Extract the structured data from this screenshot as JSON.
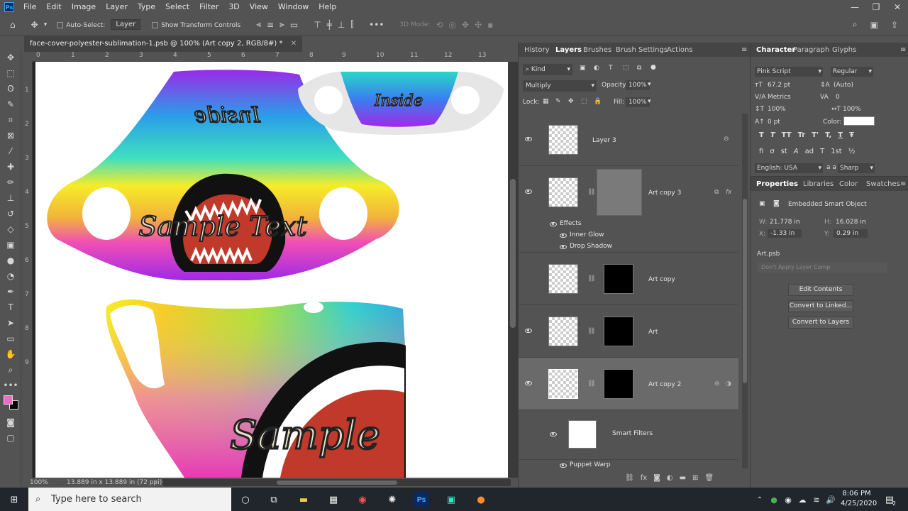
{
  "menubar": {
    "logo": "Ps",
    "items": [
      "File",
      "Edit",
      "Image",
      "Layer",
      "Type",
      "Select",
      "Filter",
      "3D",
      "View",
      "Window",
      "Help"
    ]
  },
  "options": {
    "auto_select": "Auto-Select:",
    "auto_select_value": "Layer",
    "transform_controls": "Show Transform Controls",
    "mode_3d": "3D Mode:"
  },
  "document": {
    "tab_title": "face-cover-polyester-sublimation-1.psb @ 100% (Art copy 2, RGB/8#) *",
    "zoom": "100%",
    "doc_size": "13.889 in x 13.889 in (72 ppi)",
    "ruler_h": [
      "0",
      "1",
      "2",
      "3",
      "4",
      "5",
      "6",
      "7",
      "8",
      "9",
      "10",
      "11",
      "12",
      "13"
    ],
    "ruler_v": [
      "1",
      "2",
      "3",
      "4",
      "5",
      "6",
      "7",
      "8",
      "9"
    ],
    "mask_top_text": "Inside",
    "mask_main_text": "Sample Text",
    "mask_flip_text": "Inside",
    "mask_3d_text": "Sample"
  },
  "layers_panel": {
    "tabs": [
      "History",
      "Layers",
      "Brushes",
      "Brush Settings",
      "Actions"
    ],
    "active_tab": "Layers",
    "filter_kind": "Kind",
    "blend_mode": "Multiply",
    "opacity_label": "Opacity:",
    "opacity": "100%",
    "lock_label": "Lock:",
    "fill_label": "Fill:",
    "fill": "100%",
    "layers": [
      {
        "name": "Layer 3"
      },
      {
        "name": "Art copy 3"
      },
      {
        "name": "Art copy"
      },
      {
        "name": "Art"
      },
      {
        "name": "Art copy 2"
      }
    ],
    "effects_label": "Effects",
    "effects": [
      "Inner Glow",
      "Drop Shadow"
    ],
    "smart_filters": "Smart Filters",
    "puppet_warp": "Puppet Warp"
  },
  "character_panel": {
    "tabs": [
      "Character",
      "Paragraph",
      "Glyphs"
    ],
    "font": "Pink Script",
    "style": "Regular",
    "size": "67.2 pt",
    "leading": "(Auto)",
    "kerning": "Metrics",
    "tracking": "0",
    "vscale": "100%",
    "hscale": "100%",
    "baseline": "0 pt",
    "color_label": "Color:",
    "language": "English: USA",
    "aa_label": "a a",
    "antialias": "Sharp",
    "type_buttons": [
      "T",
      "T",
      "TT",
      "Tr",
      "T'",
      "T,",
      "T",
      "Ŧ"
    ],
    "ot_buttons": [
      "fi",
      "σ",
      "st",
      "A",
      "ad",
      "T",
      "1st",
      "½"
    ]
  },
  "properties_panel": {
    "tabs": [
      "Properties",
      "Libraries",
      "Color",
      "Swatches"
    ],
    "object_type": "Embedded Smart Object",
    "w_label": "W:",
    "w": "21.778 in",
    "h_label": "H:",
    "h": "16.028 in",
    "x_label": "X:",
    "x": "-1.33 in",
    "y_label": "Y:",
    "y": "0.29 in",
    "file": "Art.psb",
    "layer_comp": "Don't Apply Layer Comp",
    "buttons": [
      "Edit Contents",
      "Convert to Linked...",
      "Convert to Layers"
    ]
  },
  "taskbar": {
    "search_placeholder": "Type here to search",
    "time": "8:06 PM",
    "date": "4/25/2020",
    "notification_count": "2"
  },
  "colors": {
    "foreground": "#f06bc8",
    "background": "#000000"
  }
}
